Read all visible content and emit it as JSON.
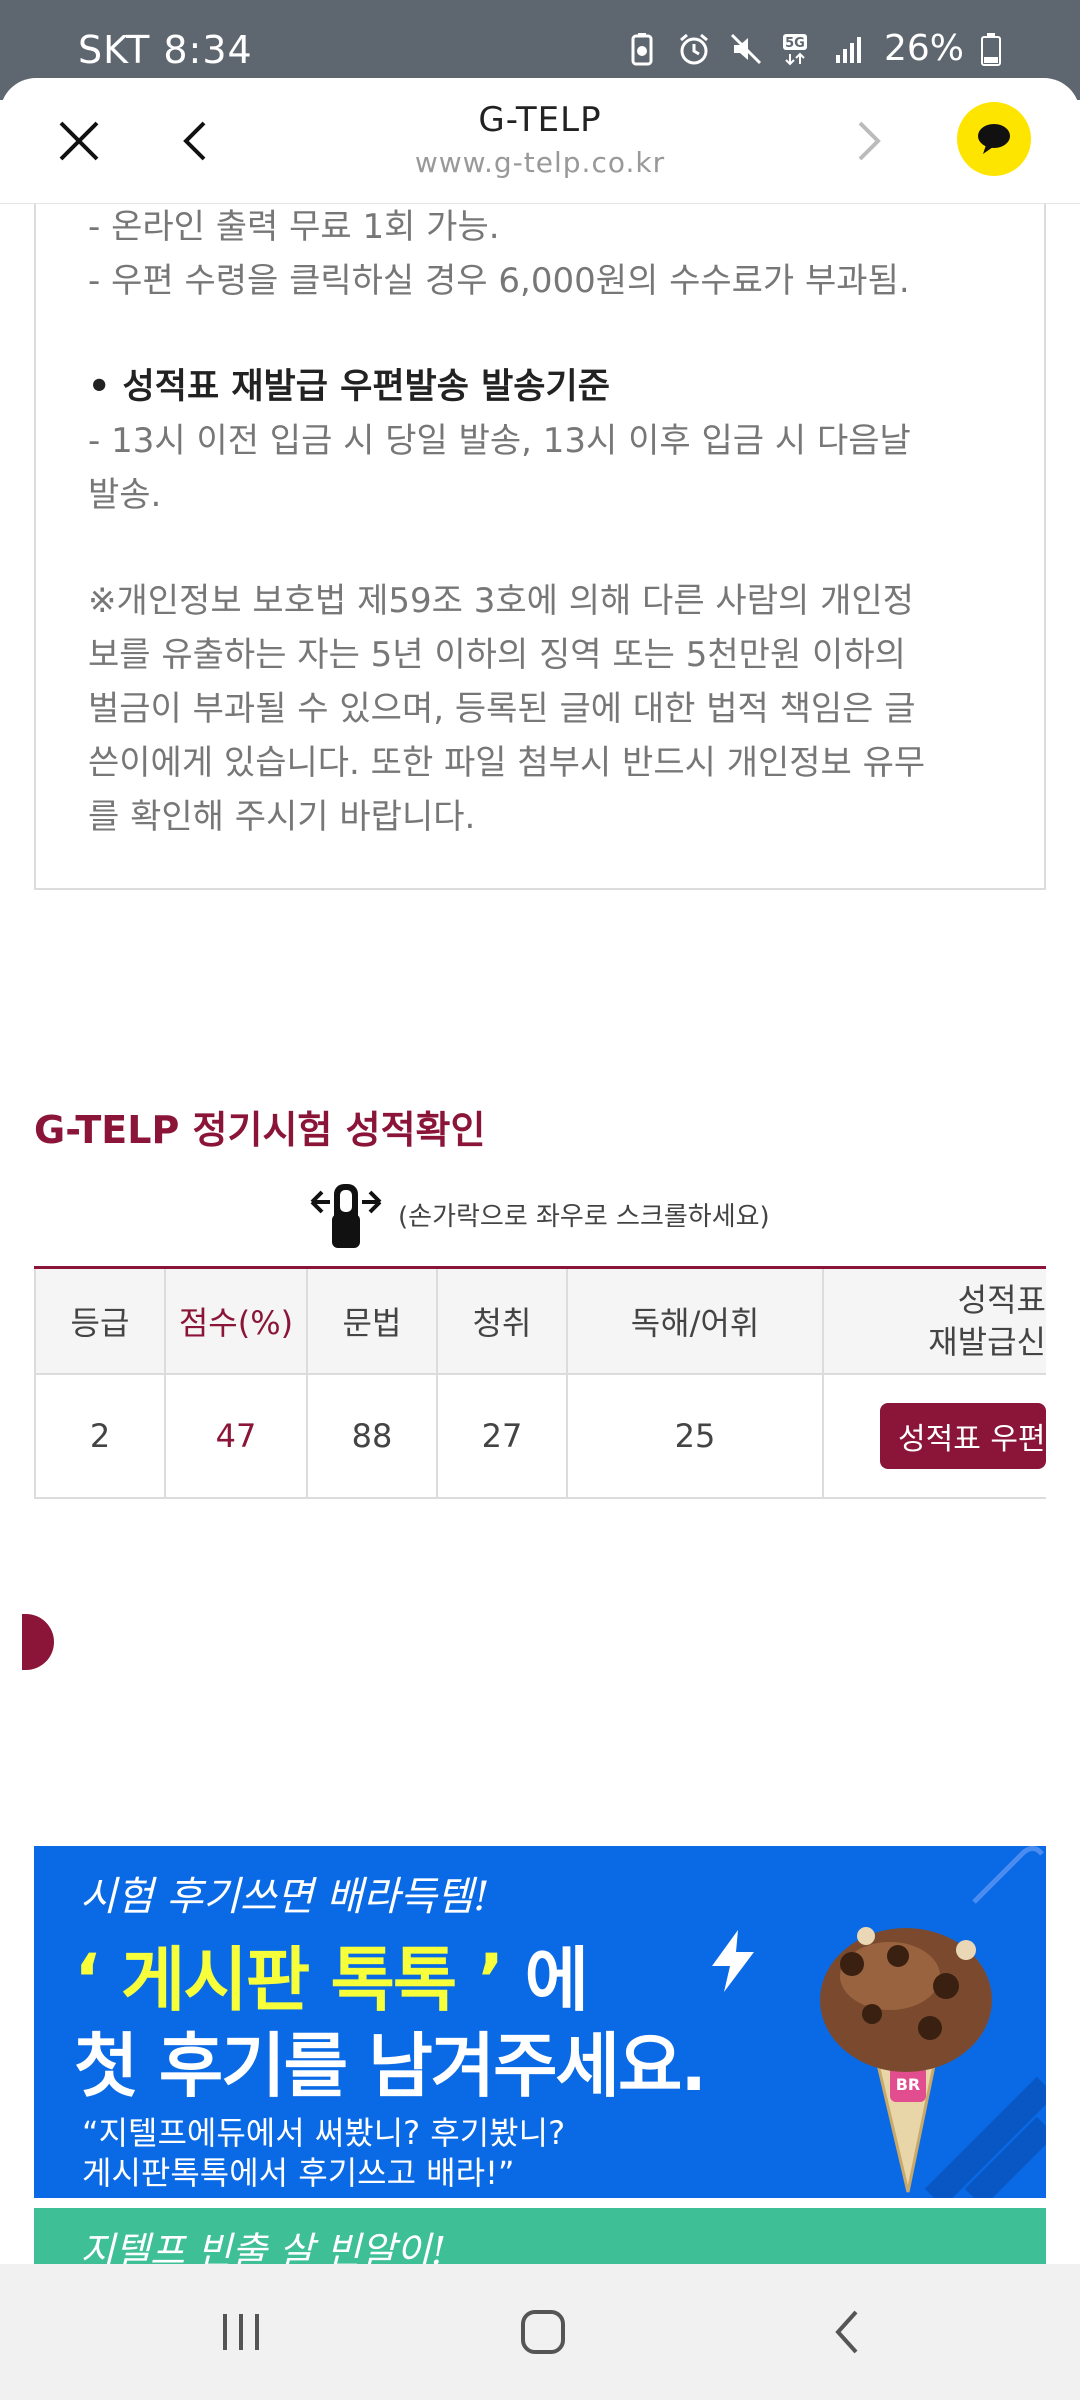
{
  "status_bar": {
    "carrier": "SKT 8:34",
    "battery": "26%",
    "network": "5G"
  },
  "browser": {
    "title": "G-TELP",
    "url": "www.g-telp.co.kr",
    "icons": [
      "close-icon",
      "back-arrow-icon",
      "forward-arrow-icon",
      "kakao-talk-icon"
    ]
  },
  "notice": {
    "lines": [
      "- 온라인 출력 무료 1회 가능.",
      "- 우편 수령을 클릭하실 경우 6,000원의 수수료가 부과됨."
    ],
    "heading": "• 성적표 재발급 우편발송 발송기준",
    "post_lines": [
      "- 13시 이전 입금 시 당일 발송, 13시 이후 입금 시 다음날",
      "발송."
    ],
    "privacy": [
      "※개인정보 보호법 제59조 3호에 의해 다른 사람의 개인정",
      "보를 유출하는 자는 5년 이하의 징역 또는 5천만원 이하의",
      "벌금이 부과될 수 있으며, 등록된 글에 대한 법적 책임은 글",
      "쓴이에게 있습니다. 또한 파일 첨부시 반드시 개인정보 유무",
      "를 확인해 주시기 바랍니다."
    ]
  },
  "score_section": {
    "title": "G-TELP 정기시험 성적확인",
    "scroll_hint": "(손가락으로 좌우로 스크롤하세요)",
    "headers": [
      "등급",
      "점수(%)",
      "문법",
      "청취",
      "독해/어휘"
    ],
    "reissue_header_line1": "성적표",
    "reissue_header_line2": "재발급신",
    "row": [
      "2",
      "47",
      "88",
      "27",
      "25"
    ],
    "reissue_button": "성적표 우편"
  },
  "banner": {
    "script": "시험 후기쓰면 배라득템!",
    "line1_hl": "‘ 게시판 톡톡 ’",
    "line1_rest": " 에",
    "line2": "첫 후기를 남겨주세요.",
    "quote1": "“지텔프에듀에서 써봤니? 후기봤니?",
    "quote2": "게시판톡톡에서 후기쓰고 배라!”",
    "bg_color": "#0a6ae6",
    "highlight_color": "#f6ff3a"
  },
  "banner2": {
    "text": "지텔프 빈출 살 빈알이!",
    "bg_color": "#3ebf95"
  },
  "accent_color": "#8b1538",
  "nav": {
    "icons": [
      "recent-apps-icon",
      "home-icon",
      "back-icon"
    ]
  }
}
